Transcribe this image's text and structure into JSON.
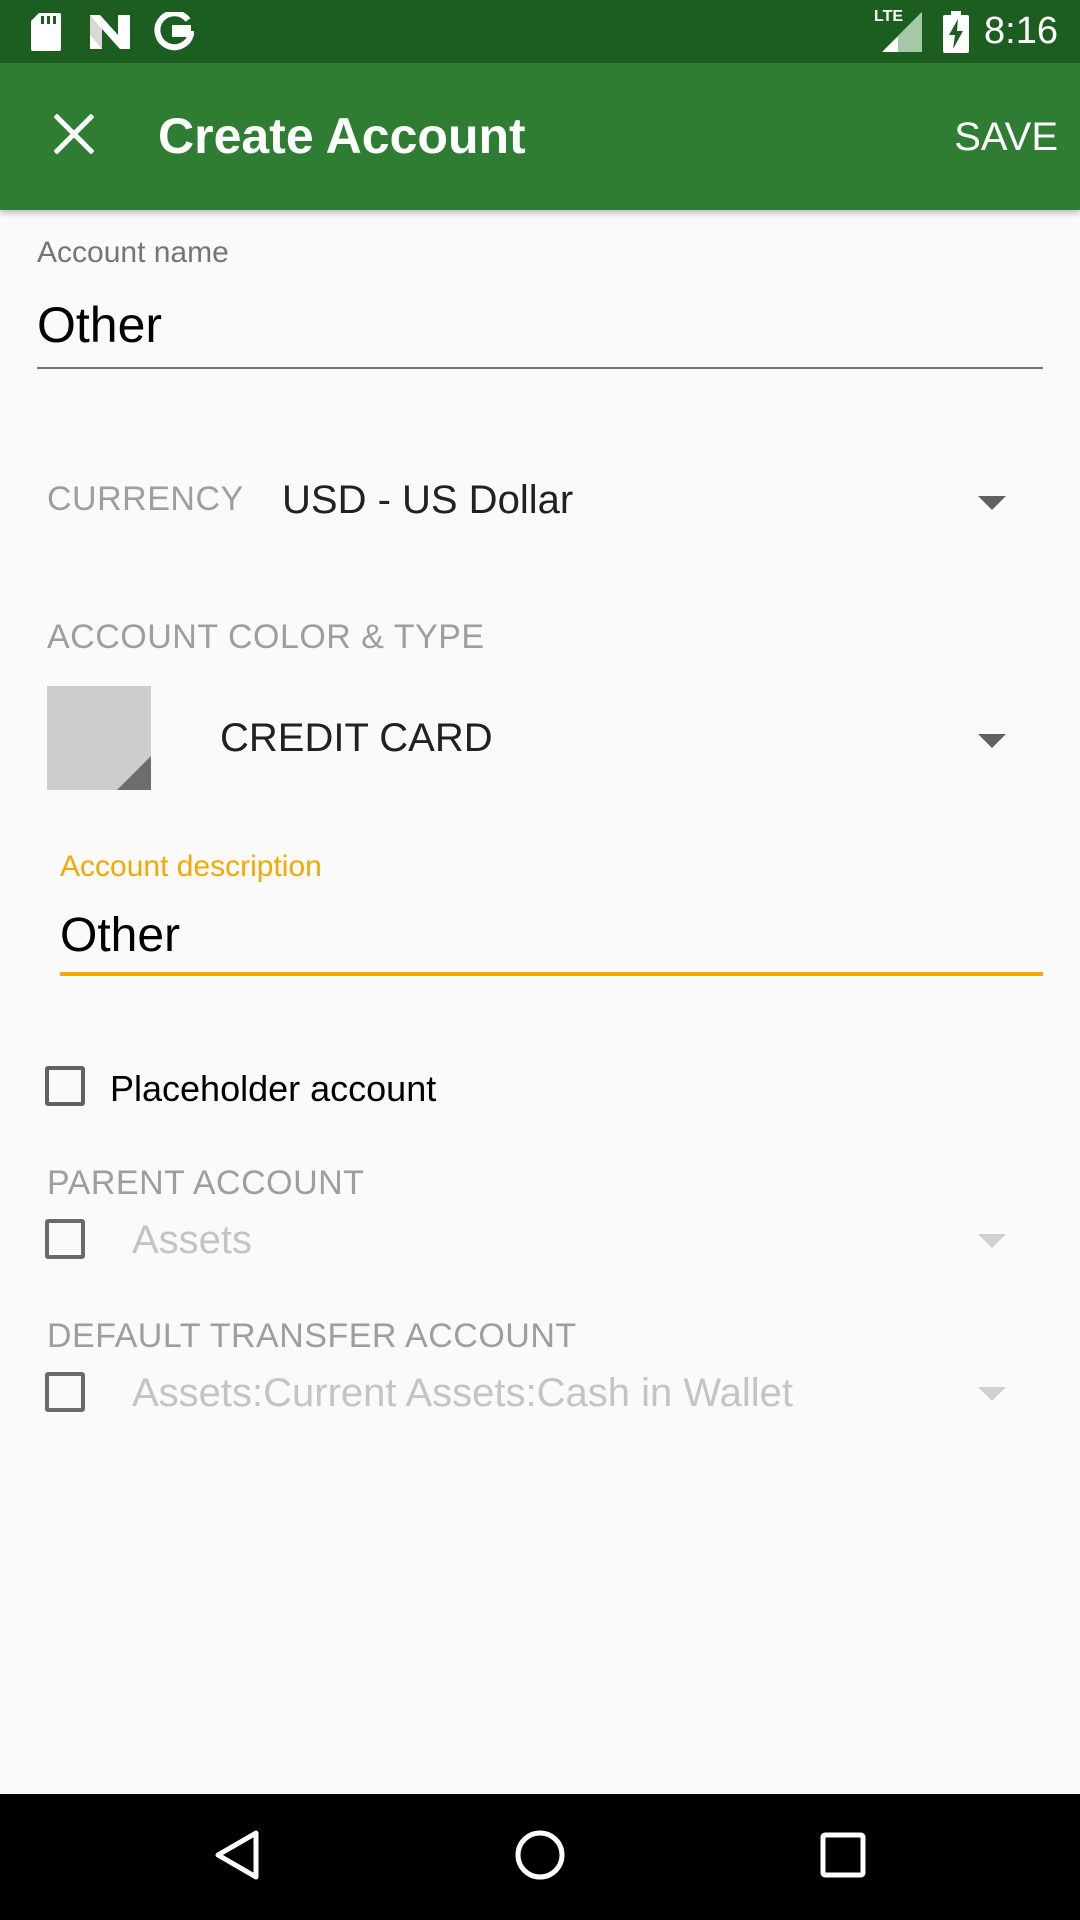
{
  "status_bar": {
    "time": "8:16",
    "network_label": "LTE",
    "icons": [
      "sd-card-icon",
      "n-notification-icon",
      "google-icon",
      "lte-signal-icon",
      "battery-charging-icon"
    ]
  },
  "app_bar": {
    "title": "Create Account",
    "save_label": "SAVE",
    "close_icon": "close-icon",
    "background": "#2e7d32",
    "status_background": "#1b5e20"
  },
  "form": {
    "account_name": {
      "label": "Account name",
      "value": "Other"
    },
    "currency": {
      "label": "CURRENCY",
      "value": "USD - US Dollar"
    },
    "color_type": {
      "label": "ACCOUNT COLOR & TYPE",
      "type_value": "CREDIT CARD",
      "swatch_color": "#cdcdcd"
    },
    "description": {
      "label": "Account description",
      "value": "Other",
      "accent_color": "#f5a800"
    },
    "placeholder": {
      "label": "Placeholder account",
      "checked": false
    },
    "parent_account": {
      "label": "PARENT ACCOUNT",
      "value": "Assets",
      "checked": false,
      "enabled": false
    },
    "default_transfer": {
      "label": "DEFAULT TRANSFER ACCOUNT",
      "value": "Assets:Current Assets:Cash in Wallet",
      "checked": false,
      "enabled": false
    }
  },
  "nav_bar": {
    "buttons": [
      "back-icon",
      "home-icon",
      "recents-icon"
    ]
  }
}
